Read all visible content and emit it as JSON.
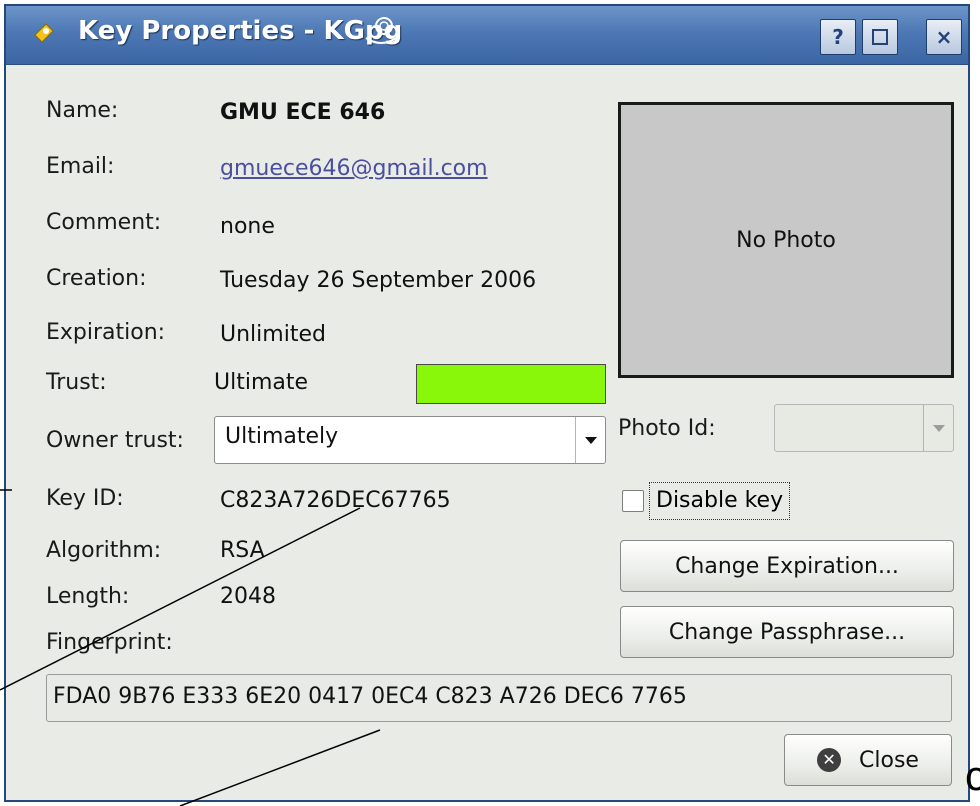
{
  "window": {
    "title": "Key Properties - KGpg",
    "help_btn": "?",
    "close_btn": "×"
  },
  "fields": {
    "name_label": "Name:",
    "name_value": "GMU ECE 646",
    "email_label": "Email:",
    "email_value": "gmuece646@gmail.com",
    "comment_label": "Comment:",
    "comment_value": "none",
    "creation_label": "Creation:",
    "creation_value": "Tuesday 26 September 2006",
    "expiration_label": "Expiration:",
    "expiration_value": "Unlimited",
    "trust_label": "Trust:",
    "trust_value": "Ultimate",
    "trust_color": "#88f70a",
    "owner_trust_label": "Owner trust:",
    "owner_trust_value": "Ultimately",
    "keyid_label": "Key ID:",
    "keyid_value": "C823A726DEC67765",
    "algorithm_label": "Algorithm:",
    "algorithm_value": "RSA",
    "length_label": "Length:",
    "length_value": "2048",
    "fingerprint_label": "Fingerprint:",
    "fingerprint_value": "FDA0 9B76 E333 6E20 0417 0EC4 C823 A726 DEC6 7765"
  },
  "photo": {
    "placeholder": "No Photo",
    "photo_id_label": "Photo Id:",
    "photo_id_value": ""
  },
  "actions": {
    "disable_key_label": "Disable key",
    "disable_key_checked": false,
    "change_expiration_label": "Change Expiration...",
    "change_passphrase_label": "Change Passphrase...",
    "close_label": "Close"
  },
  "annotation": {
    "letter": "c"
  },
  "icons": {
    "app": "kgpg-key-icon",
    "swirl": "kde-swirl-icon",
    "close": "close-circle-icon"
  }
}
